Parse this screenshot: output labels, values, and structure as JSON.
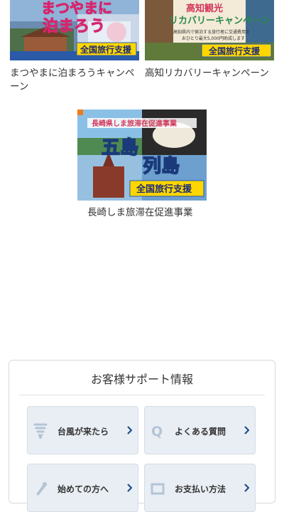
{
  "campaigns": [
    {
      "caption_line1": "まつやまに泊まろうキャンペ",
      "caption_line2": "ーン",
      "image_text_1": "まつやまに",
      "image_text_2": "泊まろう",
      "badge": "全国旅行支援"
    },
    {
      "caption_line1": "高知リカバリーキャンペーン",
      "image_text_1": "高知観光",
      "image_text_2": "リカバリーキャンペーン",
      "image_text_3": "高知県内で宿泊する旅行者に交通費用を",
      "image_text_4": "おひとり最大5,000円助成します",
      "badge": "全国旅行支援"
    },
    {
      "caption_line1": "長崎しま旅滞在促進事業",
      "image_text_1": "長崎県しま旅滞在促進事業",
      "image_text_2": "五島",
      "image_text_3": "列島",
      "badge": "全国旅行支援"
    }
  ],
  "support": {
    "title": "お客様サポート情報",
    "tiles": [
      {
        "label": "台風が来たら",
        "icon": "typhoon-icon"
      },
      {
        "label": "よくある質問",
        "icon": "q-icon"
      },
      {
        "label": "始めての方へ",
        "icon": "pen-icon"
      },
      {
        "label": "お支払い方法",
        "icon": "card-icon"
      }
    ]
  },
  "colors": {
    "tile_bg": "#e9eef4",
    "tile_icon": "#b3c4d6",
    "chevron": "#1f4f8a",
    "badge_bg": "#ffd600",
    "badge_text": "#1a2a7a"
  }
}
